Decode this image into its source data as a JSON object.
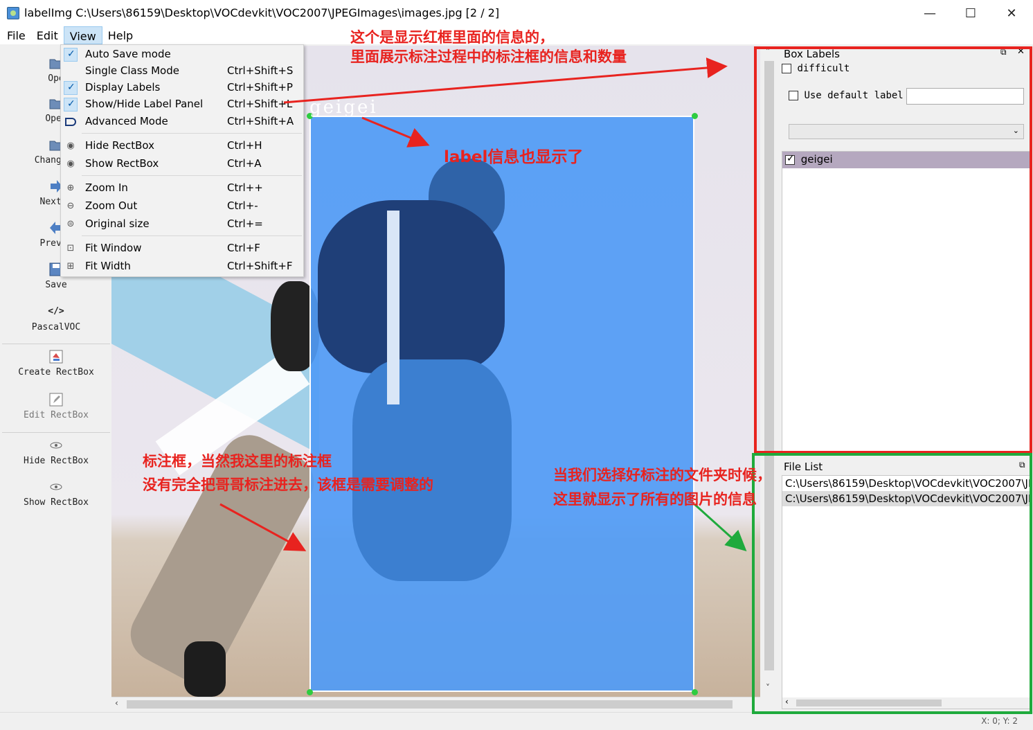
{
  "window": {
    "title": "labelImg C:\\Users\\86159\\Desktop\\VOCdevkit\\VOC2007\\JPEGImages\\images.jpg [2 / 2]",
    "minimize": "—",
    "maximize": "☐",
    "close": "✕"
  },
  "menubar": [
    "File",
    "Edit",
    "View",
    "Help"
  ],
  "toolbar": {
    "open": "Ope",
    "open_dir": "Open",
    "change_save": "Change S",
    "next": "Next I",
    "prev": "Prev I",
    "save": "Save",
    "format_icon": "</>",
    "format": "PascalVOC",
    "create": "Create RectBox",
    "edit": "Edit RectBox",
    "hide": "Hide RectBox",
    "show": "Show RectBox"
  },
  "view_menu": [
    {
      "label": "Auto Save mode",
      "shortcut": "",
      "checked": true
    },
    {
      "label": "Single Class Mode",
      "shortcut": "Ctrl+Shift+S",
      "checked": false
    },
    {
      "label": "Display Labels",
      "shortcut": "Ctrl+Shift+P",
      "checked": true
    },
    {
      "label": "Show/Hide Label Panel",
      "shortcut": "Ctrl+Shift+L",
      "checked": true
    },
    {
      "label": "Advanced Mode",
      "shortcut": "Ctrl+Shift+A",
      "checked": false
    },
    {
      "label": "Hide RectBox",
      "shortcut": "Ctrl+H",
      "icon": "eye-icon"
    },
    {
      "label": "Show RectBox",
      "shortcut": "Ctrl+A",
      "icon": "eye-icon"
    },
    {
      "label": "Zoom In",
      "shortcut": "Ctrl++",
      "icon": "zoom-in-icon"
    },
    {
      "label": "Zoom Out",
      "shortcut": "Ctrl+-",
      "icon": "zoom-out-icon"
    },
    {
      "label": "Original size",
      "shortcut": "Ctrl+=",
      "icon": "zoom-original-icon"
    },
    {
      "label": "Fit Window",
      "shortcut": "Ctrl+F",
      "icon": "fit-window-icon"
    },
    {
      "label": "Fit Width",
      "shortcut": "Ctrl+Shift+F",
      "icon": "fit-width-icon"
    }
  ],
  "canvas": {
    "box_label": "geigei"
  },
  "box_labels_dock": {
    "title": "Box Labels",
    "difficult": "difficult",
    "use_default_label": "Use default label",
    "default_label_value": "",
    "labels": [
      {
        "text": "geigei",
        "checked": true
      }
    ]
  },
  "file_list_dock": {
    "title": "File List",
    "files": [
      "C:\\Users\\86159\\Desktop\\VOCdevkit\\VOC2007\\JP",
      "C:\\Users\\86159\\Desktop\\VOCdevkit\\VOC2007\\JP"
    ]
  },
  "status": {
    "text": "X: 0; Y: 2"
  },
  "annotations": {
    "top_line1": "这个是显示红框里面的信息的，",
    "top_line2": "里面展示标注过程中的标注框的信息和数量",
    "label": "label信息也显示了",
    "box_line1": "标注框，当然我这里的标注框",
    "box_line2": "没有完全把哥哥标注进去，该框是需要调整的",
    "files_line1": "当我们选择好标注的文件夹时候，",
    "files_line2": "这里就显示了所有的图片的信息"
  },
  "colors": {
    "annotation_red": "#e8231f",
    "annotation_green": "#1faa3c",
    "box_fill": "#509bf5",
    "vertex": "#2ecc40"
  }
}
